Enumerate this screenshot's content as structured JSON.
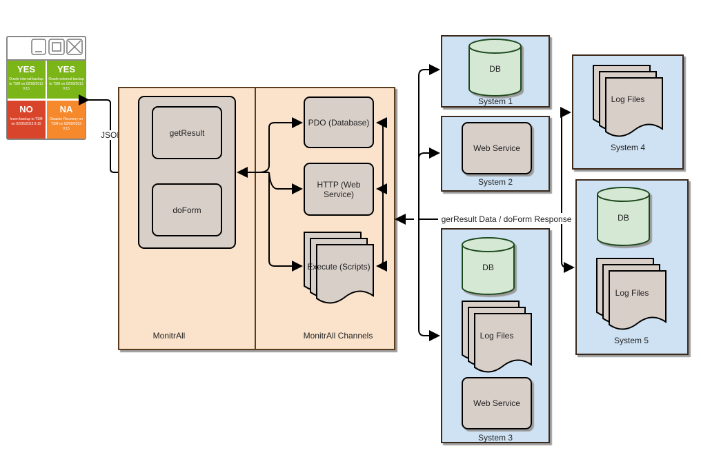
{
  "widget": {
    "tiles": [
      {
        "status": "YES",
        "text": [
          "Oracle internal backup",
          "to TSM on 02/08/2013",
          "9:15"
        ],
        "color": "#7cb518"
      },
      {
        "status": "YES",
        "text": [
          "Oracle external backup",
          "to TSM on 02/09/2013",
          "9:15"
        ],
        "color": "#7cb518"
      },
      {
        "status": "NO",
        "text": [
          "Incen backup to TSM",
          "on 02/05/2013 9:15"
        ],
        "color": "#d9452a"
      },
      {
        "status": "NA",
        "text": [
          "Disaster Recovery on",
          "TSM on 02/09/2013",
          "9:15"
        ],
        "color": "#f5892c"
      }
    ]
  },
  "json_label": "JSON",
  "monitrall": {
    "label": "MonitrAll",
    "get_result": "getResult",
    "do_form": "doForm"
  },
  "channels": {
    "label": "MonitrAll Channels",
    "pdo": "PDO (Database)",
    "http": [
      "HTTP (Web",
      "Service)"
    ],
    "execute": "Execute (Scripts)"
  },
  "bus_label": "gerResult Data / doForm Response",
  "systems": {
    "s1": {
      "label": "System 1",
      "db": "DB"
    },
    "s2": {
      "label": "System 2",
      "ws": "Web Service"
    },
    "s3": {
      "label": "System 3",
      "db": "DB",
      "logs": "Log Files",
      "ws": "Web Service"
    },
    "s4": {
      "label": "System 4",
      "logs": "Log Files"
    },
    "s5": {
      "label": "System 5",
      "db": "DB",
      "logs": "Log Files"
    }
  },
  "colors": {
    "monitrall_fill": "#fbe3cb",
    "system_fill": "#cfe2f3",
    "component_fill": "#d9cfc9",
    "db_fill": "#d5e8d4"
  }
}
